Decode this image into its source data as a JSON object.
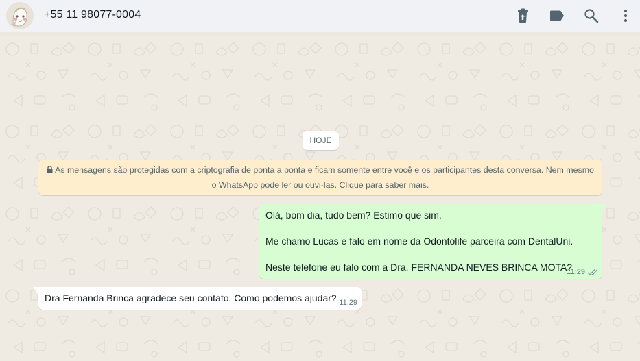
{
  "header": {
    "contact_name": "+55 11 98077-0004",
    "icons": [
      "delete-icon",
      "label-icon",
      "search-icon",
      "menu-icon"
    ]
  },
  "chat": {
    "day_label": "HOJE",
    "encryption_notice": {
      "line1": "As mensagens são protegidas com a criptografia de ponta a ponta e ficam somente entre você e os participantes desta conversa. Nem mesmo",
      "line2": "o WhatsApp pode ler ou ouvi-las. Clique para saber mais."
    },
    "messages": [
      {
        "direction": "outgoing",
        "lines": [
          "Olá, bom dia, tudo bem? Estimo que sim.",
          "Me chamo Lucas e falo em nome da Odontolife parceira com DentalUni.",
          "Neste telefone eu falo com a Dra. FERNANDA NEVES BRINCA MOTA?"
        ],
        "time": "11:29",
        "status": "read"
      },
      {
        "direction": "incoming",
        "text": "Dra Fernanda Brinca agradece seu contato. Como podemos ajudar?",
        "time": "11:29"
      }
    ]
  },
  "colors": {
    "header_bg": "#f0f2f5",
    "chat_bg": "#efeae2",
    "outgoing_bubble": "#d9fdd3",
    "incoming_bubble": "#ffffff",
    "notice_bg": "#ffeecd",
    "read_tick": "#8696a0"
  }
}
